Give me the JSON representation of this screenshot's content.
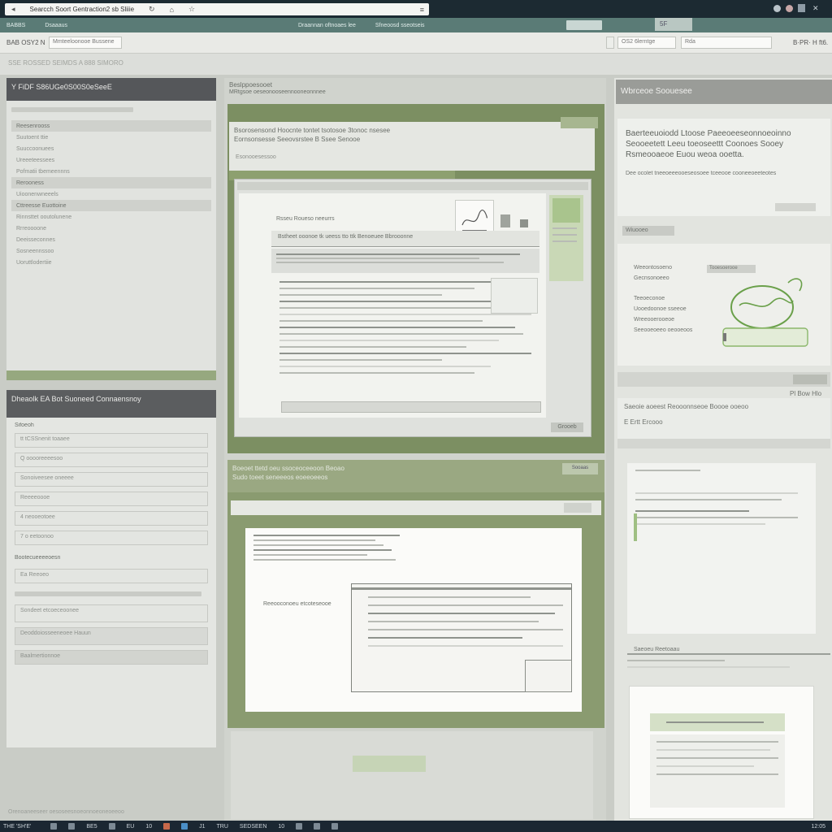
{
  "browser": {
    "url_text": "Searcch Soort Gentraction2 sb Sliiie",
    "icons": [
      "back-icon",
      "refresh-icon",
      "home-icon",
      "star-icon",
      "menu-icon"
    ],
    "controls": [
      "minimize-icon",
      "maximize-icon",
      "close-icon",
      "menu-icon"
    ]
  },
  "appbar": {
    "items": [
      "BABBS",
      "Dsaaaus",
      "Draannan oftnoaes lee",
      "Sfneoosd sseotseis"
    ]
  },
  "toolbar": {
    "left_label": "BAB OSY2 N",
    "left_input": "Mmteeloonooe  Bussene",
    "right_input_1": "OS2 6lerntge",
    "right_input_2": "Rda",
    "right_label": "B·PR· H ft6.",
    "right_badge": "5F"
  },
  "breadcrumb": "SSE ROSSED  SEIMDS A 888 SIMORO",
  "left_panel": {
    "header": "Y  FiDF S86UGe0S00S0eSeeE",
    "rows": [
      "Reesenrooss",
      "Suutoent  ttie",
      "Suuccoonuees",
      "Ureeeteessees",
      "Pofmatii tbemeennns",
      "Rerooness",
      "Uioonenwneeels",
      "Cttreesse  Euottoine",
      "Rinnsttet ooutolunene",
      "Rrreoooone",
      "Deeisseconnes",
      "Sosneennssoo",
      "Uoruttlodertiie"
    ],
    "section2_title": "Dheaolk EA Bot Suoneed Connaensnoy",
    "section2_sub": "Sifoeoh",
    "form_rows": [
      "tt tCSSnenit  toaaee",
      "Q  ooooreeeesoo",
      "Sonoiveesee oneeee",
      "Reeeeoooe",
      "4 neooeotoee",
      "7 o eetoonoo",
      "Bootecueeeeoesn",
      "Ea  Reeoeo",
      "Sondeet etcoeceoonee",
      "Deoddoiosseeneoee  Hauun",
      "Baalmertionnoe"
    ],
    "footer": "Orenoaneeseer oesoseesnoeonnoeoneoeeoo"
  },
  "center_panel": {
    "header_title": "Beslppoesooet",
    "header_sub": "MRtgsoe oeseonooseennooneonnnee",
    "card1": {
      "title": "Bsorosensond Hoocnte tontet tsotosoe 3tonoc nsesee",
      "subtitle": "Eornsonsesse Seeovsrstee B Ssee Senooe",
      "tab": "Esonooesessoo",
      "doc_title": "Rsseu Roueso neeurrs",
      "doc_heading": "Bstheet ooonoe  tk  ueess tto  ttk  Benoeuee  Bbrooonne",
      "footer_button": "Grooeb"
    },
    "card2": {
      "title": "Boeoet ttetd oeu ssoceoceeoon Beoao",
      "subtitle": "Sudo toeet seneeeos eoeeoeeos",
      "badge": "Sooaas",
      "doc_row": "Reeooconoeu etcoteseooe"
    }
  },
  "right_panel": {
    "title": "Wbrceoe Soouesee",
    "headline": "Baerteeuoiodd Ltoose Paeeoeeseonnoeoinno Seooeetett  Leeu toeoseettt Coonoes  Sooey Rsmeooaeoe Euou  weoa ooetta.",
    "sub": "Dee ocolet tneeoeeeooeseosoee tceeooe cooneeoeeteotes",
    "badge": "Wiuooeo",
    "tag": "Tooesoerooe",
    "list": [
      "Weeontosoeno",
      "Gecnsonoeeo",
      "Teeoeconoe",
      "Uooedoonoe sseeoe",
      "Wreeooerooeoe",
      "Seeooeoeeo oeooeoos"
    ],
    "status": "Pl  Bow  Hlo",
    "mid_heading": "Saeoie aoeest Reooonnseoe  Boooe  ooeoo",
    "mid_sub": "E  Ertt  Ercooo",
    "list_heading": "Saeoeu Reetoaau"
  },
  "taskbar": {
    "left_label": "THE 'SH'E'",
    "items": [
      "BE5",
      "EU",
      "10",
      "J1",
      "TRU",
      "SEDSEEN",
      "10"
    ],
    "clock": "12:05"
  }
}
